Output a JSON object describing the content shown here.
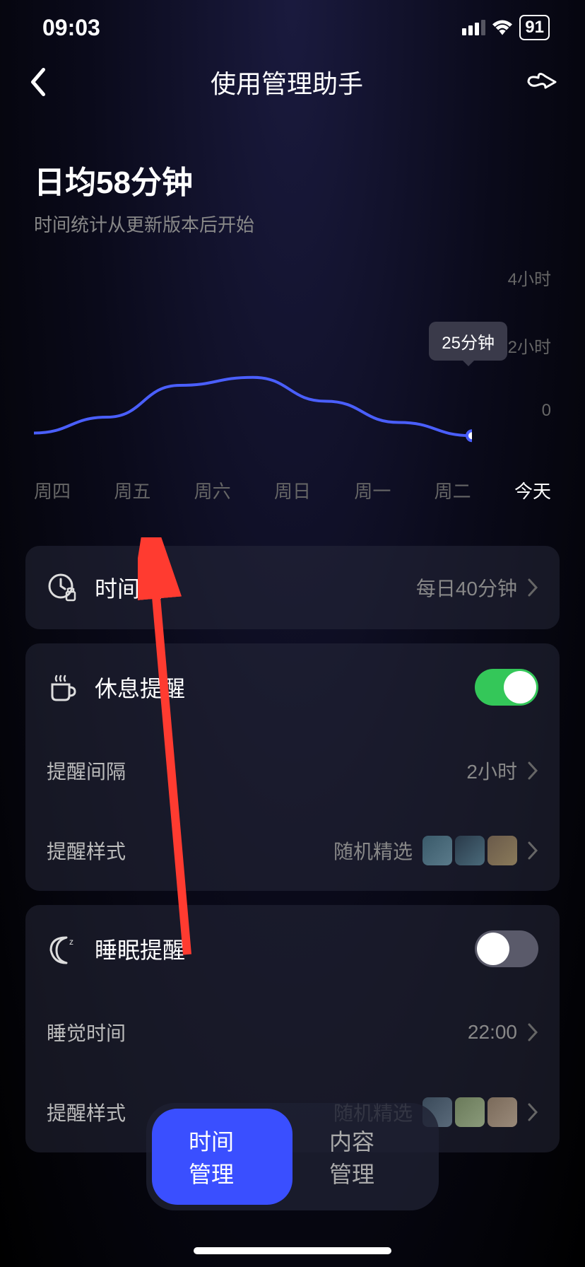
{
  "status": {
    "time": "09:03",
    "battery": "91"
  },
  "nav": {
    "title": "使用管理助手"
  },
  "stats": {
    "avg_title": "日均58分钟",
    "avg_sub": "时间统计从更新版本后开始"
  },
  "chart_data": {
    "type": "line",
    "categories": [
      "周四",
      "周五",
      "周六",
      "周日",
      "周一",
      "周二",
      "今天"
    ],
    "values": [
      30,
      60,
      120,
      135,
      90,
      50,
      25
    ],
    "ylabel": "",
    "ylim": [
      0,
      240
    ],
    "y_ticks": [
      "4小时",
      "2小时",
      "0"
    ],
    "tooltip_value": "25分钟",
    "highlighted_index": 6
  },
  "sections": {
    "time_lock": {
      "label": "时间锁",
      "value": "每日40分钟"
    },
    "rest_reminder": {
      "label": "休息提醒",
      "on": true,
      "interval_label": "提醒间隔",
      "interval_value": "2小时",
      "style_label": "提醒样式",
      "style_value": "随机精选"
    },
    "sleep_reminder": {
      "label": "睡眠提醒",
      "on": false,
      "time_label": "睡觉时间",
      "time_value": "22:00",
      "style_label": "提醒样式",
      "style_value": "随机精选"
    }
  },
  "tabs": {
    "time": "时间管理",
    "content": "内容管理"
  }
}
